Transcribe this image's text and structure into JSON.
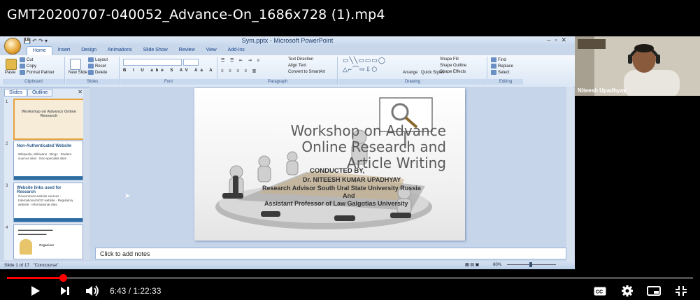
{
  "video": {
    "title": "GMT20200707-040052_Advance-On_1686x728 (1).mp4",
    "time_current": "6:43",
    "time_total": "1:22:33",
    "time_display": "6:43 / 1:22:33",
    "progress_fraction": 0.0814,
    "progress_color": "#ff0000"
  },
  "powerpoint": {
    "window_title": "Sym.pptx - Microsoft PowerPoint",
    "tabs": [
      "Home",
      "Insert",
      "Design",
      "Animations",
      "Slide Show",
      "Review",
      "View",
      "Add-Ins"
    ],
    "active_tab": "Home",
    "ribbon": {
      "clipboard": {
        "label": "Clipboard",
        "paste": "Paste",
        "cut": "Cut",
        "copy": "Copy",
        "format_painter": "Format Painter"
      },
      "slides": {
        "label": "Slides",
        "new_slide": "New Slide",
        "layout": "Layout",
        "reset": "Reset",
        "delete": "Delete"
      },
      "font": {
        "label": "Font"
      },
      "paragraph": {
        "label": "Paragraph",
        "text_direction": "Text Direction",
        "align_text": "Align Text",
        "convert_smartart": "Convert to SmartArt"
      },
      "drawing": {
        "label": "Drawing",
        "arrange": "Arrange",
        "quick_styles": "Quick Styles",
        "shape_fill": "Shape Fill",
        "shape_outline": "Shape Outline",
        "shape_effects": "Shape Effects"
      },
      "editing": {
        "label": "Editing",
        "find": "Find",
        "replace": "Replace",
        "select": "Select"
      }
    },
    "pane_tabs": [
      "Slides",
      "Outline"
    ],
    "thumbnails": [
      {
        "num": "1",
        "title": "Workshop on Advance Online Research",
        "body": ""
      },
      {
        "num": "2",
        "title": "Non-Authenticated Website",
        "body": "Wikipedia, Wikiwane · Blogs · Student sources sites · Non-specialist sites"
      },
      {
        "num": "3",
        "title": "Website links used for Research",
        "body": "Government website sources · International NGO website · Regulatory website · Informational sites"
      },
      {
        "num": "4",
        "title": "",
        "body": "Organiser"
      }
    ],
    "slide": {
      "title_line1": "Workshop on Advance",
      "title_line2": "Online Research and",
      "title_line3": "Article Writing",
      "conducted_by": "CONDUCTED BY,",
      "presenter": "Dr. NITEESH KUMAR UPADHYAY",
      "role1": "Research Advisor South Ural State University Russia",
      "and": "And",
      "role2": "Assistant Professor of Law Galgotias University"
    },
    "notes_placeholder": "Click to add notes",
    "status_slide": "Slide 1 of 17",
    "status_theme": "\"Concourse\"",
    "zoom": "60%"
  },
  "webcam": {
    "participant_name": "Niteesh Upadhyay"
  }
}
